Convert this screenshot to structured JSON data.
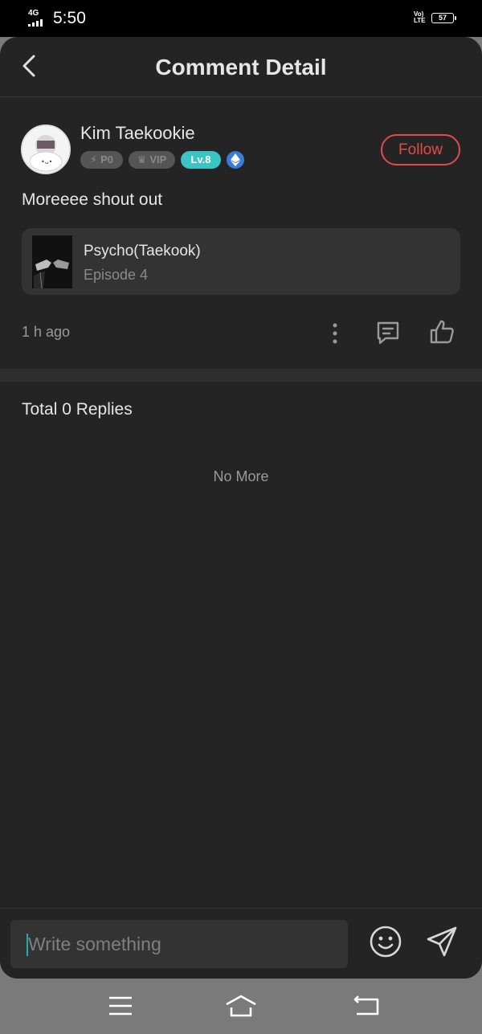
{
  "status_bar": {
    "network": "4G",
    "time": "5:50",
    "volte": "Vo) LTE",
    "battery": "57"
  },
  "header": {
    "title": "Comment Detail"
  },
  "comment": {
    "username": "Kim Taekookie",
    "badges": {
      "points": "P0",
      "vip": "VIP",
      "level": "Lv.8"
    },
    "follow_label": "Follow",
    "text": "Moreeee shout out",
    "episode": {
      "title": "Psycho(Taekook)",
      "subtitle": "Episode 4"
    },
    "time_ago": "1 h ago"
  },
  "replies": {
    "total_label": "Total 0 Replies",
    "end_label": "No More"
  },
  "input": {
    "placeholder": "Write something"
  },
  "colors": {
    "accent": "#e24b4b",
    "level_badge": "#3cc3c3",
    "background": "#242424"
  },
  "icons": [
    "back-icon",
    "more-vertical-icon",
    "reply-icon",
    "thumbs-up-icon",
    "emoji-icon",
    "send-icon",
    "menu-icon",
    "home-icon",
    "return-icon"
  ]
}
